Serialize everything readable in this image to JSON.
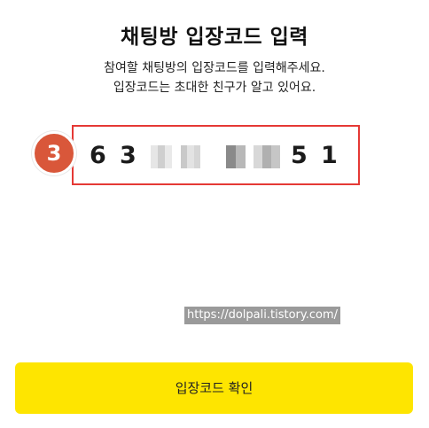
{
  "page": {
    "title": "채팅방 입장코드 입력",
    "description_line1": "참여할 채팅방의 입장코드를 입력해주세요.",
    "description_line2": "입장코드는 초대한 친구가 알고 있어요."
  },
  "code_input": {
    "digits": [
      "6",
      "3",
      "",
      "",
      "",
      "",
      "5",
      "1"
    ],
    "blurred_positions": [
      3,
      4,
      5,
      6
    ]
  },
  "annotation": {
    "step_number": "3",
    "badge_color": "#d9573a",
    "highlight_color": "#e53935"
  },
  "watermark": {
    "text": "https://dolpali.tistory.com/"
  },
  "confirm_button": {
    "label": "입장코드 확인",
    "color": "#fee500"
  }
}
